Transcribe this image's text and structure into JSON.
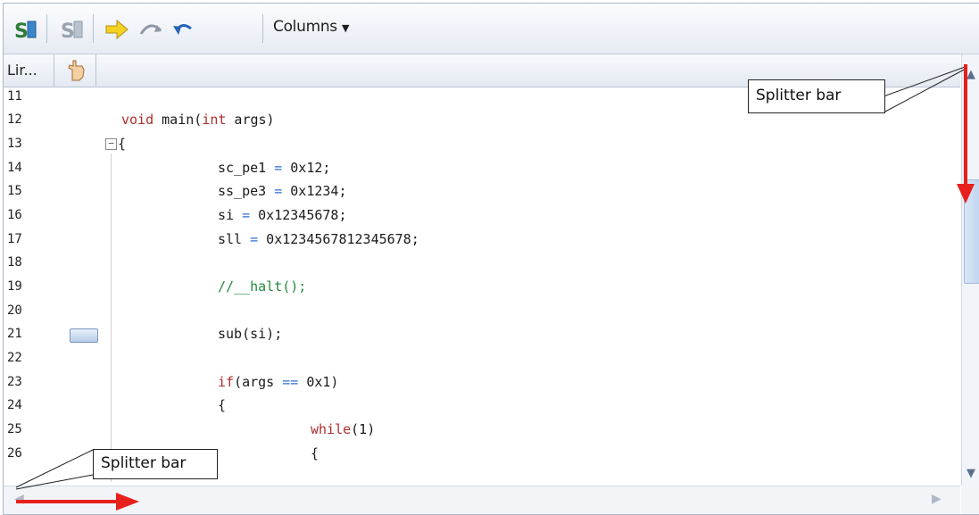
{
  "toolbar": {
    "columns_label": "Columns",
    "icons": [
      "source-path-icon",
      "source-path-disabled-icon",
      "go-to-pc-icon",
      "step-over-icon",
      "undo-icon",
      "columns-dropdown-icon"
    ]
  },
  "header": {
    "line_col_label": "Lir...",
    "breakpoint_col_icon": "hand-pointer-icon"
  },
  "code_lines": [
    {
      "ln": "11"
    },
    {
      "ln": "12"
    },
    {
      "ln": "13"
    },
    {
      "ln": "14"
    },
    {
      "ln": "15"
    },
    {
      "ln": "16"
    },
    {
      "ln": "17"
    },
    {
      "ln": "18"
    },
    {
      "ln": "19"
    },
    {
      "ln": "20"
    },
    {
      "ln": "21"
    },
    {
      "ln": "22"
    },
    {
      "ln": "23"
    },
    {
      "ln": "24"
    },
    {
      "ln": "25"
    },
    {
      "ln": "26"
    }
  ],
  "code": {
    "l12_a": "void",
    "l12_b": " main(",
    "l12_c": "int",
    "l12_d": " args)",
    "l13": "{",
    "l14_a": "sc_pe1 ",
    "l14_b": "=",
    "l14_c": " 0x12;",
    "l15_a": "ss_pe3 ",
    "l15_b": "=",
    "l15_c": " 0x1234;",
    "l16_a": "si ",
    "l16_b": "=",
    "l16_c": " 0x12345678;",
    "l17_a": "sll ",
    "l17_b": "=",
    "l17_c": " 0x1234567812345678;",
    "l19": "//__halt();",
    "l21": "sub(si);",
    "l23_a": "if",
    "l23_b": "(args ",
    "l23_c": "==",
    "l23_d": " 0x1)",
    "l24": "{",
    "l25_a": "while",
    "l25_b": "(1)",
    "l26": "{"
  },
  "annotations": {
    "top_splitter": "Splitter bar",
    "bottom_splitter": "Splitter bar",
    "arrow_color": "#e8201b"
  },
  "colors": {
    "keyword": "#b02d2d",
    "operator": "#2f6fd0",
    "comment": "#1f8a3a"
  }
}
